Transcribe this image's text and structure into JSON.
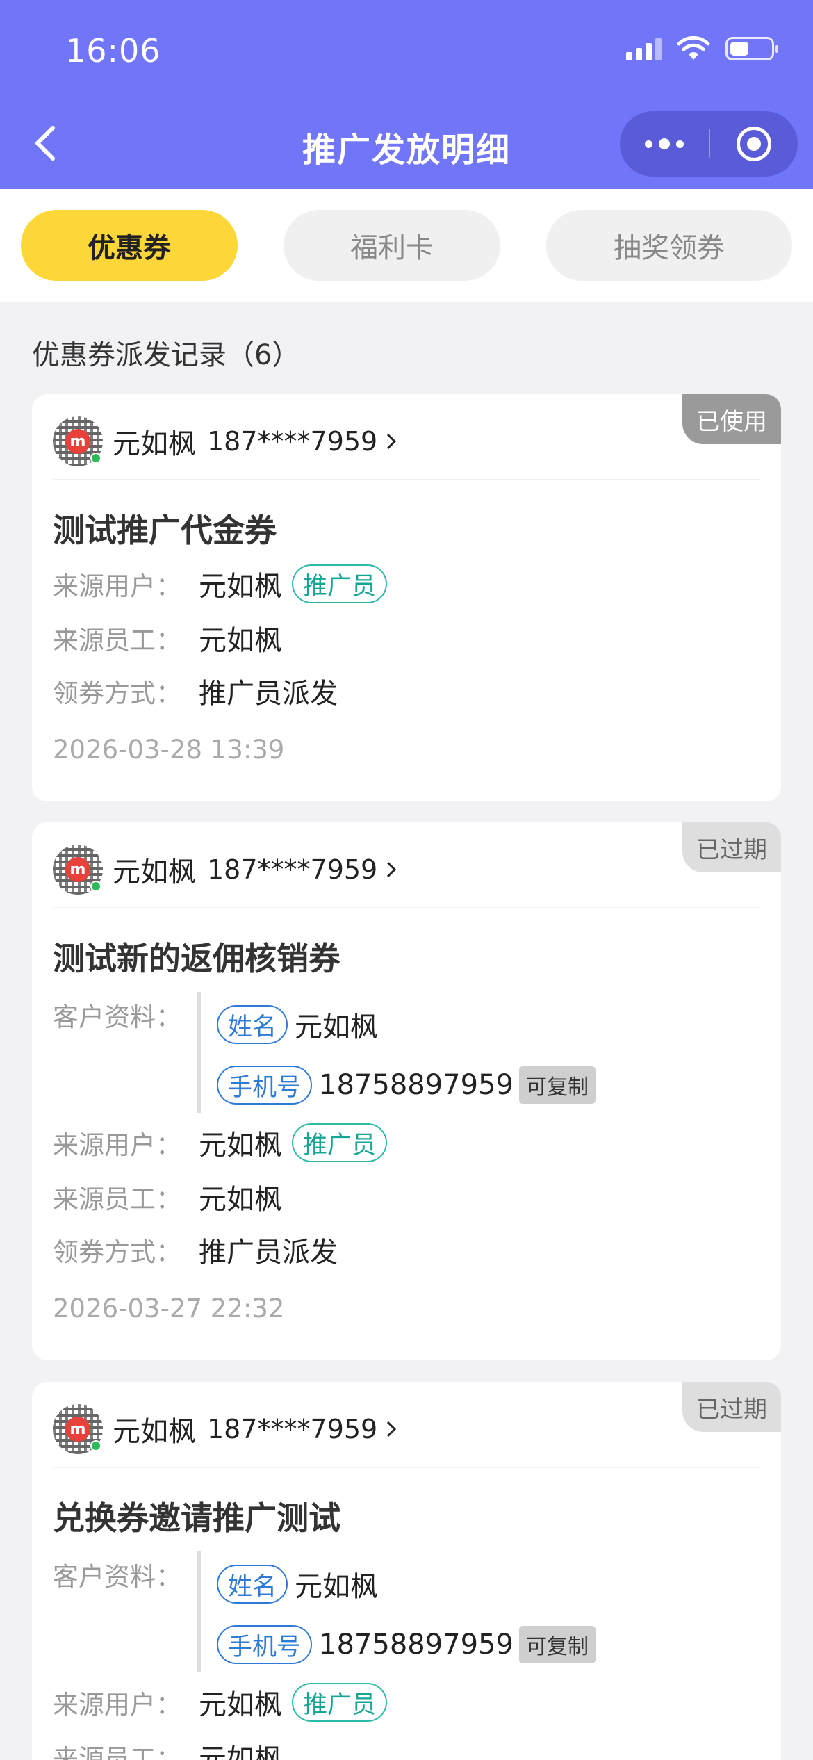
{
  "status_bar": {
    "time": "16:06"
  },
  "nav": {
    "title": "推广发放明细",
    "back_icon": "chevron-left-icon",
    "more_icon": "more-dots-icon",
    "close_icon": "target-icon"
  },
  "tabs": [
    {
      "label": "优惠券",
      "active": true
    },
    {
      "label": "福利卡",
      "active": false
    },
    {
      "label": "抽奖领券",
      "active": false
    }
  ],
  "section_title": "优惠券派发记录（6）",
  "labels": {
    "source_user": "来源用户：",
    "source_staff": "来源员工：",
    "claim_method": "领券方式：",
    "customer_profile": "客户资料：",
    "name_tag": "姓名",
    "phone_tag": "手机号",
    "copy": "可复制",
    "promoter": "推广员"
  },
  "records": [
    {
      "status": "已使用",
      "user_name": "元如枫",
      "user_phone": "187****7959",
      "coupon_name": "测试推广代金券",
      "source_user": "元如枫",
      "source_staff": "元如枫",
      "claim_method": "推广员派发",
      "date": "2026-03-28 13:39"
    },
    {
      "status": "已过期",
      "user_name": "元如枫",
      "user_phone": "187****7959",
      "coupon_name": "测试新的返佣核销券",
      "profile_name": "元如枫",
      "profile_phone": "18758897959",
      "source_user": "元如枫",
      "source_staff": "元如枫",
      "claim_method": "推广员派发",
      "date": "2026-03-27 22:32"
    },
    {
      "status": "已过期",
      "user_name": "元如枫",
      "user_phone": "187****7959",
      "coupon_name": "兑换券邀请推广测试",
      "profile_name": "元如枫",
      "profile_phone": "18758897959",
      "source_user": "元如枫",
      "source_staff": "元如枫"
    }
  ]
}
